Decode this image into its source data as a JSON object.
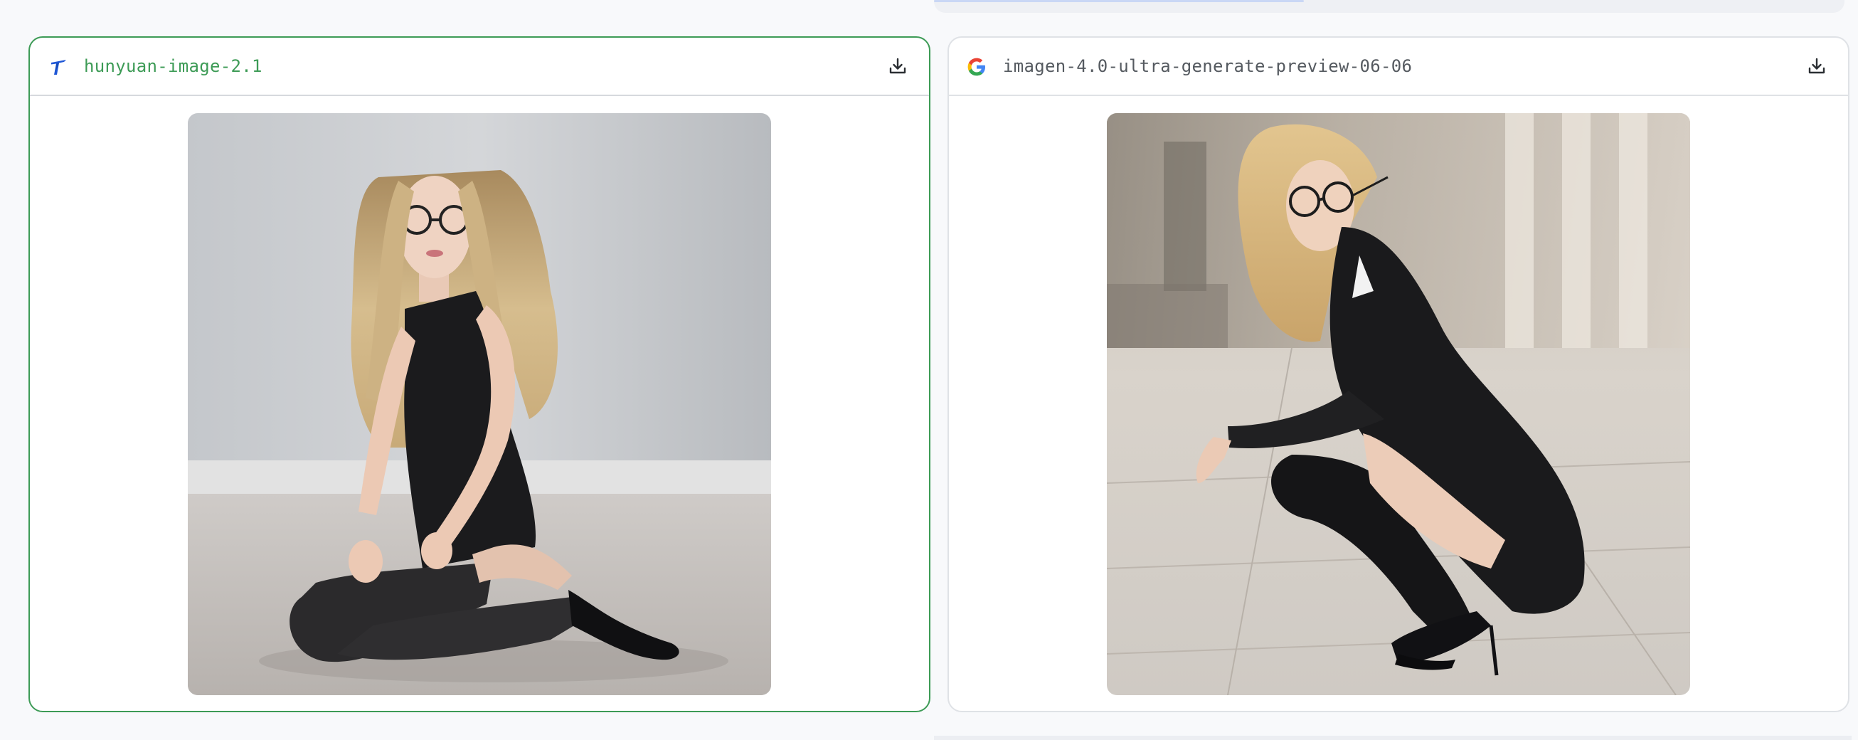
{
  "colors": {
    "selected_border": "#3d9b56",
    "selected_name": "#3d9b56",
    "default_name": "#555a60",
    "download_icon": "#2b2f33"
  },
  "cards": [
    {
      "model_name": "hunyuan-image-2.1",
      "provider_icon": "hunyuan-logo-icon",
      "selected": true,
      "download_icon": "download-icon",
      "image_description": "Woman with long blonde hair and glasses in a black dress and black stockings, sitting on a floor against a light grey wall"
    },
    {
      "model_name": "imagen-4.0-ultra-generate-preview-06-06",
      "provider_icon": "google-logo-icon",
      "selected": false,
      "download_icon": "download-icon",
      "image_description": "Woman with curly blonde hair and glasses in a black blazer, black knee socks and heels, crouching on a paved city street"
    }
  ]
}
